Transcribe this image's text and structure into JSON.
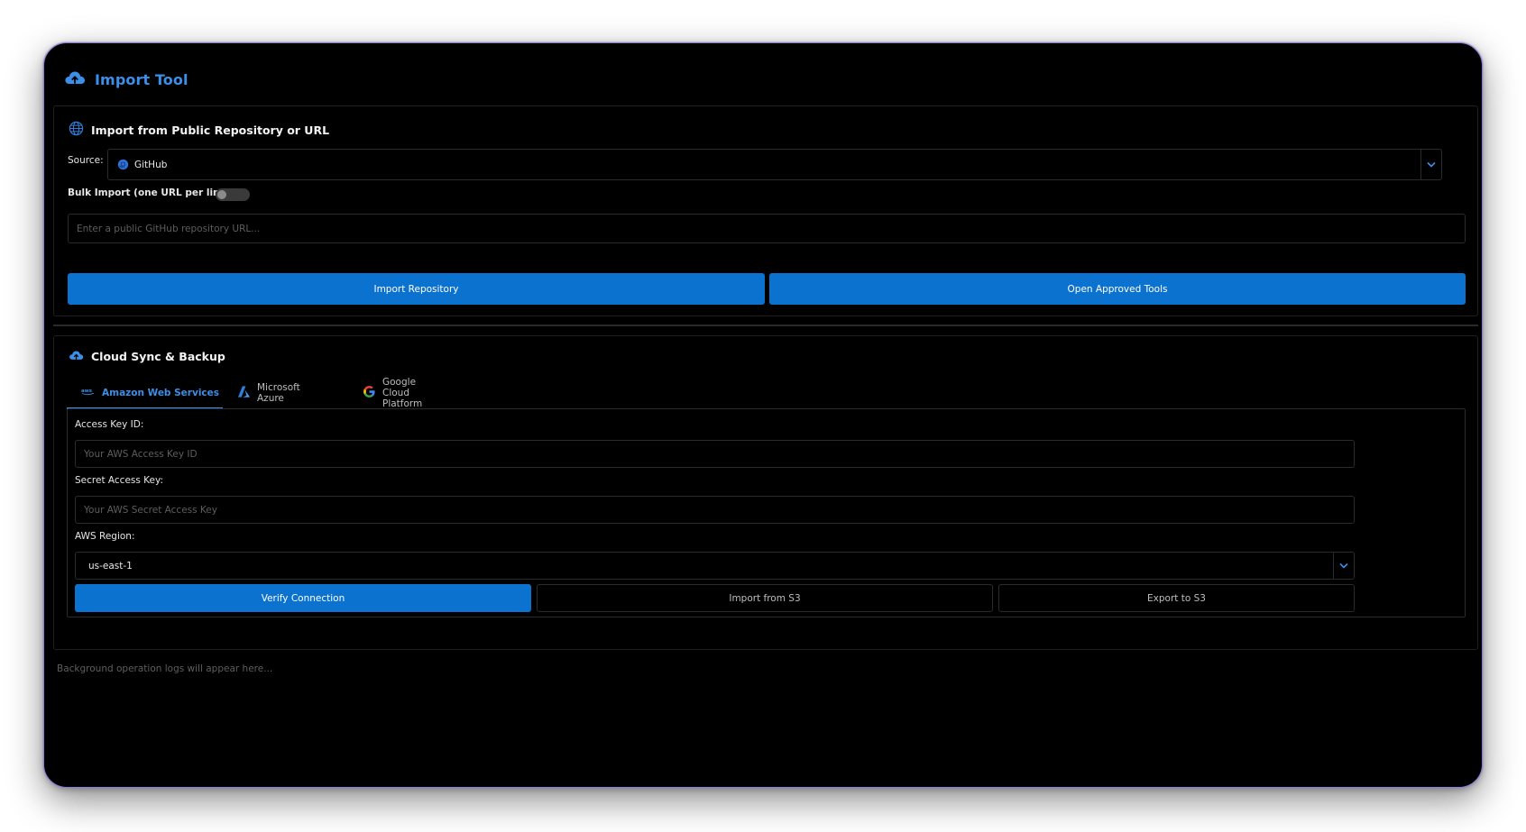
{
  "app": {
    "title": "Import Tool",
    "icon": "cloud-upload-icon",
    "accent": "#3b8fe8"
  },
  "import_section": {
    "title": "Import from Public Repository or URL",
    "icon": "globe-icon",
    "source_label": "Source:",
    "source_value": "GitHub",
    "source_icon": "github-icon",
    "bulk_label": "Bulk Import (one URL per line)",
    "bulk_enabled": false,
    "url_placeholder": "Enter a public GitHub repository URL...",
    "import_button": "Import Repository",
    "approved_button": "Open Approved Tools",
    "button_color": "#0c72cf"
  },
  "cloud_section": {
    "title": "Cloud Sync & Backup",
    "icon": "cloud-upload-icon",
    "tabs": [
      {
        "label": "Amazon Web Services",
        "icon": "aws-icon",
        "active": true
      },
      {
        "label": "Microsoft Azure",
        "icon": "azure-icon",
        "active": false
      },
      {
        "label": "Google Cloud Platform",
        "icon": "google-icon",
        "active": false
      }
    ],
    "aws": {
      "access_key_label": "Access Key ID:",
      "access_key_placeholder": "Your AWS Access Key ID",
      "secret_key_label": "Secret Access Key:",
      "secret_key_placeholder": "Your AWS Secret Access Key",
      "region_label": "AWS Region:",
      "region_value": "us-east-1",
      "verify_button": "Verify Connection",
      "import_button": "Import from S3",
      "export_button": "Export to S3"
    }
  },
  "logs": {
    "placeholder": "Background operation logs will appear here..."
  }
}
